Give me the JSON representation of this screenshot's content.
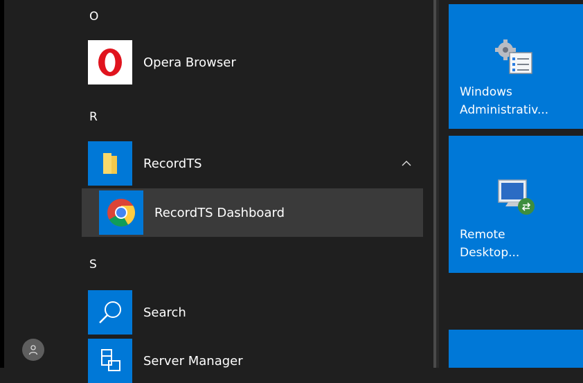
{
  "start_menu": {
    "groups": [
      {
        "letter": "O",
        "apps": [
          {
            "label": "Opera Browser",
            "icon": "opera-icon"
          }
        ]
      },
      {
        "letter": "R",
        "apps": [
          {
            "label": "RecordTS",
            "icon": "folder-icon",
            "expanded": true,
            "children": [
              {
                "label": "RecordTS Dashboard",
                "icon": "chrome-icon"
              }
            ]
          }
        ]
      },
      {
        "letter": "S",
        "apps": [
          {
            "label": "Search",
            "icon": "search-icon"
          },
          {
            "label": "Server Manager",
            "icon": "server-manager-icon"
          }
        ]
      }
    ],
    "user_icon": "user-icon"
  },
  "tiles": [
    {
      "line1": "Windows",
      "line2": "Administrativ...",
      "icon": "admin-tools-icon"
    },
    {
      "line1": "Remote",
      "line2": "Desktop...",
      "icon": "remote-desktop-icon"
    },
    {
      "line1": "",
      "line2": "",
      "icon": ""
    }
  ],
  "colors": {
    "tile_blue": "#0078d7",
    "background": "#1f1f1f",
    "selected_row": "#3a3a3a"
  }
}
